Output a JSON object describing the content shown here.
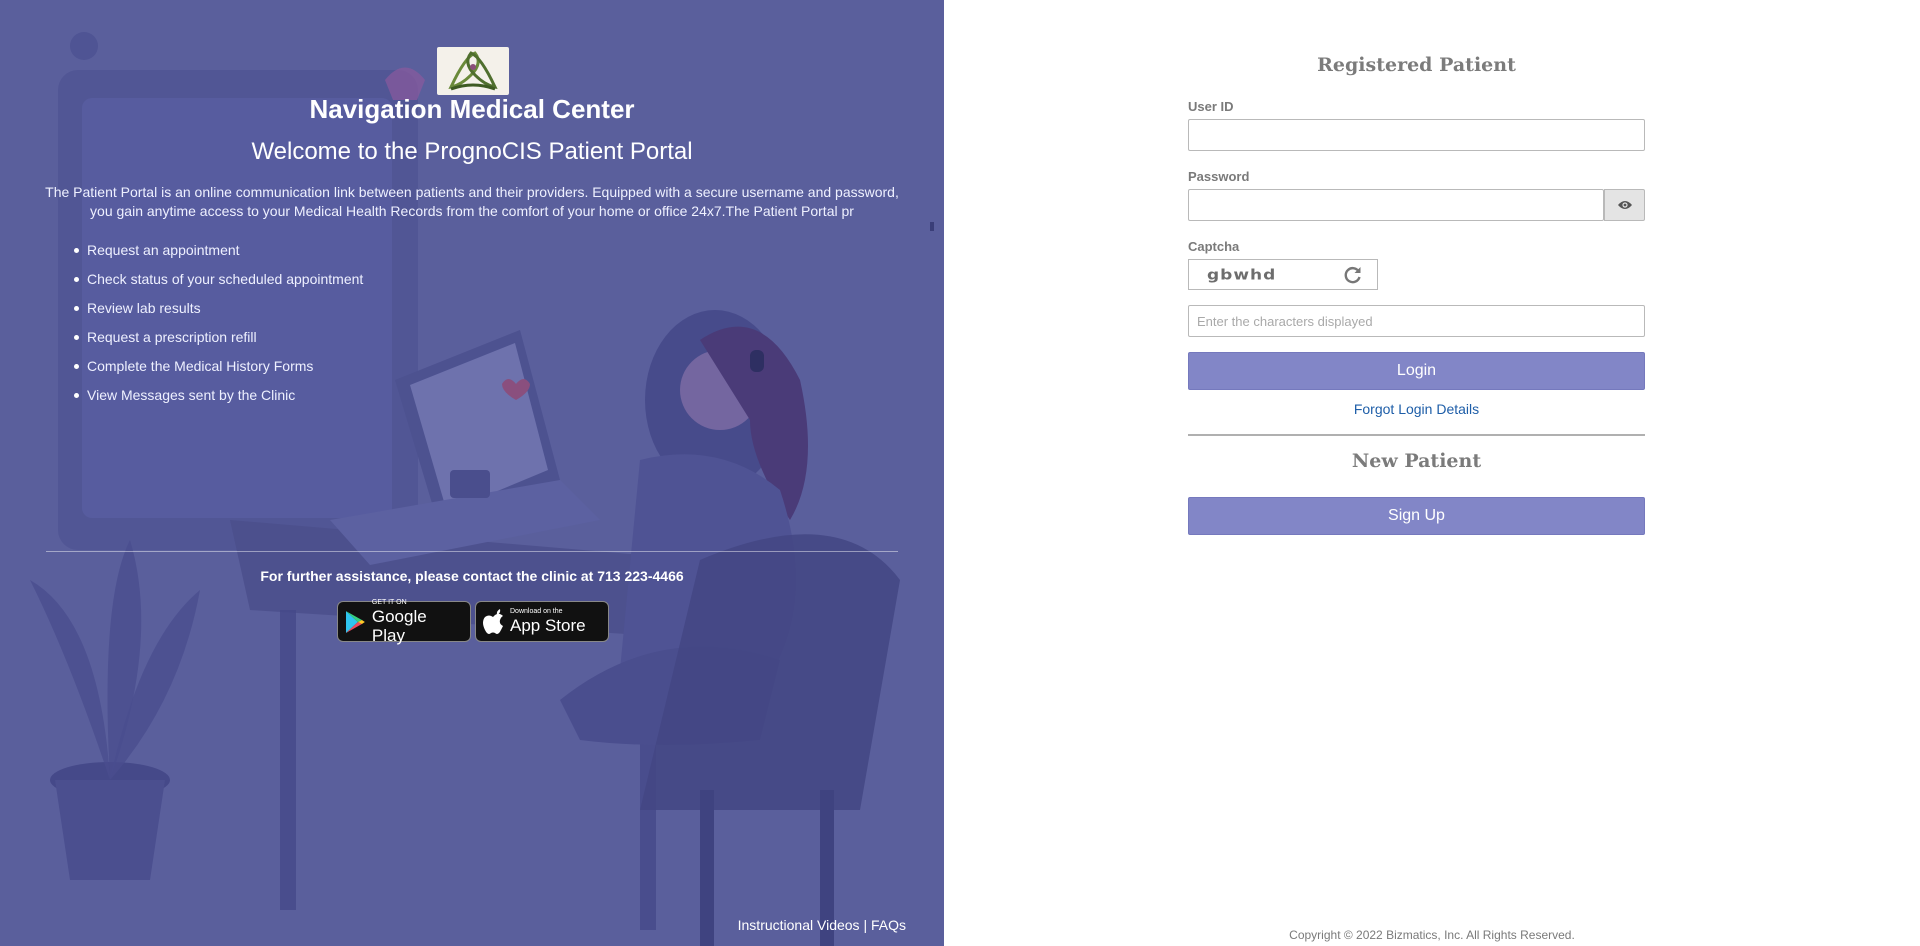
{
  "left_panel": {
    "clinic_name": "Navigation Medical Center",
    "welcome_title": "Welcome to the PrognoCIS Patient Portal",
    "intro_text": "The Patient Portal is an online communication link between patients and their providers. Equipped with a secure username and password, you gain anytime access to your Medical Health Records from the comfort of your home or office 24x7.The Patient Portal pr",
    "features": [
      "Request an appointment",
      "Check status of your scheduled appointment",
      "Review lab results",
      "Request a prescription refill",
      "Complete the Medical History Forms",
      "View Messages sent by the Clinic"
    ],
    "assistance_text": "For further assistance, please contact the clinic at 713 223-4466",
    "google_play": {
      "small": "GET IT ON",
      "big": "Google Play"
    },
    "app_store": {
      "small": "Download on the",
      "big": "App Store"
    },
    "instructional_videos": "Instructional Videos",
    "separator": "|",
    "faqs": "FAQs",
    "background_color": "#5a5f9c"
  },
  "registered": {
    "heading": "Registered Patient",
    "user_id_label": "User ID",
    "user_id_value": "",
    "password_label": "Password",
    "password_value": "",
    "captcha_label": "Captcha",
    "captcha_text": "gbwhd",
    "captcha_placeholder": "Enter the characters displayed",
    "login_label": "Login",
    "forgot_label": "Forgot Login Details"
  },
  "new_patient": {
    "heading": "New Patient",
    "signup_label": "Sign Up"
  },
  "footer": {
    "copyright": "Copyright © 2022 Bizmatics, Inc. All Rights Reserved."
  },
  "colors": {
    "accent_button": "#8286c7",
    "link": "#1e5ea8",
    "heading_gray": "#7b7b7b"
  },
  "icons": [
    "logo-icon",
    "eye-icon",
    "refresh-icon",
    "google-play-icon",
    "apple-icon"
  ]
}
